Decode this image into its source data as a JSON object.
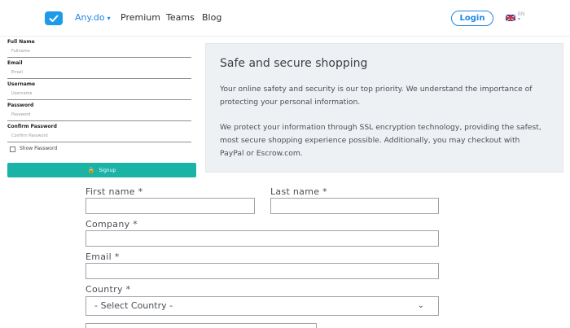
{
  "nav": {
    "brand": "Any.do",
    "brand_chevron": "▾",
    "links": [
      "Premium",
      "Teams",
      "Blog"
    ],
    "login": "Login",
    "language_top": "EN",
    "language_bottom": "▾",
    "accent_color": "#1e88e5"
  },
  "signup": {
    "fields": [
      {
        "label": "Full Name",
        "placeholder": "Fullname"
      },
      {
        "label": "Email",
        "placeholder": "Email"
      },
      {
        "label": "Username",
        "placeholder": "Username"
      },
      {
        "label": "Password",
        "placeholder": "Password"
      },
      {
        "label": "Confirm Password",
        "placeholder": "Confirm Password"
      }
    ],
    "show_password": "Show Password",
    "button": "Signup",
    "button_color": "#1ab3a6"
  },
  "secure": {
    "title": "Safe and secure shopping",
    "para1": "Your online safety and security is our top priority. We understand the importance of protecting your personal information.",
    "para2": "We protect your information through SSL encryption technology, providing the safest, most secure shopping experience possible. Additionally, you may checkout with PayPal or Escrow.com."
  },
  "checkout": {
    "first_name": "First name *",
    "last_name": "Last name *",
    "company": "Company *",
    "email": "Email *",
    "country": "Country *",
    "country_value": "- Select Country -",
    "country_chevron": "⌄"
  }
}
